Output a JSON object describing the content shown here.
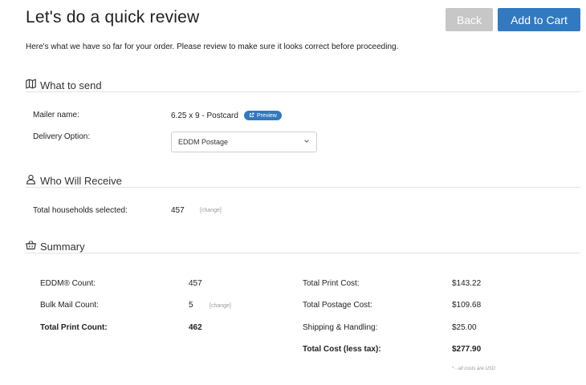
{
  "header": {
    "title": "Let's do a quick review",
    "back_label": "Back",
    "cart_label": "Add to Cart"
  },
  "intro": "Here's what we have so far for your order. Please review to make sure it looks correct before proceeding.",
  "what_to_send": {
    "heading": "What to send",
    "mailer_label": "Mailer name:",
    "mailer_value": "6.25 x 9 - Postcard",
    "preview_label": "Preview",
    "delivery_label": "Delivery Option:",
    "delivery_selected": "EDDM Postage"
  },
  "who_will_receive": {
    "heading": "Who Will Receive",
    "households_label": "Total households selected:",
    "households_value": "457",
    "change_label": "[change]"
  },
  "summary": {
    "heading": "Summary",
    "eddm_label": "EDDM® Count:",
    "eddm_value": "457",
    "bulk_label": "Bulk Mail Count:",
    "bulk_value": "5",
    "bulk_change": "[change]",
    "total_print_count_label": "Total Print Count:",
    "total_print_count_value": "462",
    "print_cost_label": "Total Print Cost:",
    "print_cost_value": "$143.22",
    "postage_label": "Total Postage Cost:",
    "postage_value": "$109.68",
    "shipping_label": "Shipping & Handling:",
    "shipping_value": "$25.00",
    "total_label": "Total Cost (less tax):",
    "total_value": "$277.90",
    "footnote": "* - all costs are USD"
  },
  "colors": {
    "primary": "#3279bf",
    "disabled": "#c7c7c7"
  },
  "icons": {
    "what_to_send": "map-icon",
    "who_will_receive": "user-icon",
    "summary": "basket-icon",
    "preview": "external-link-icon",
    "select": "chevron-down-icon"
  }
}
